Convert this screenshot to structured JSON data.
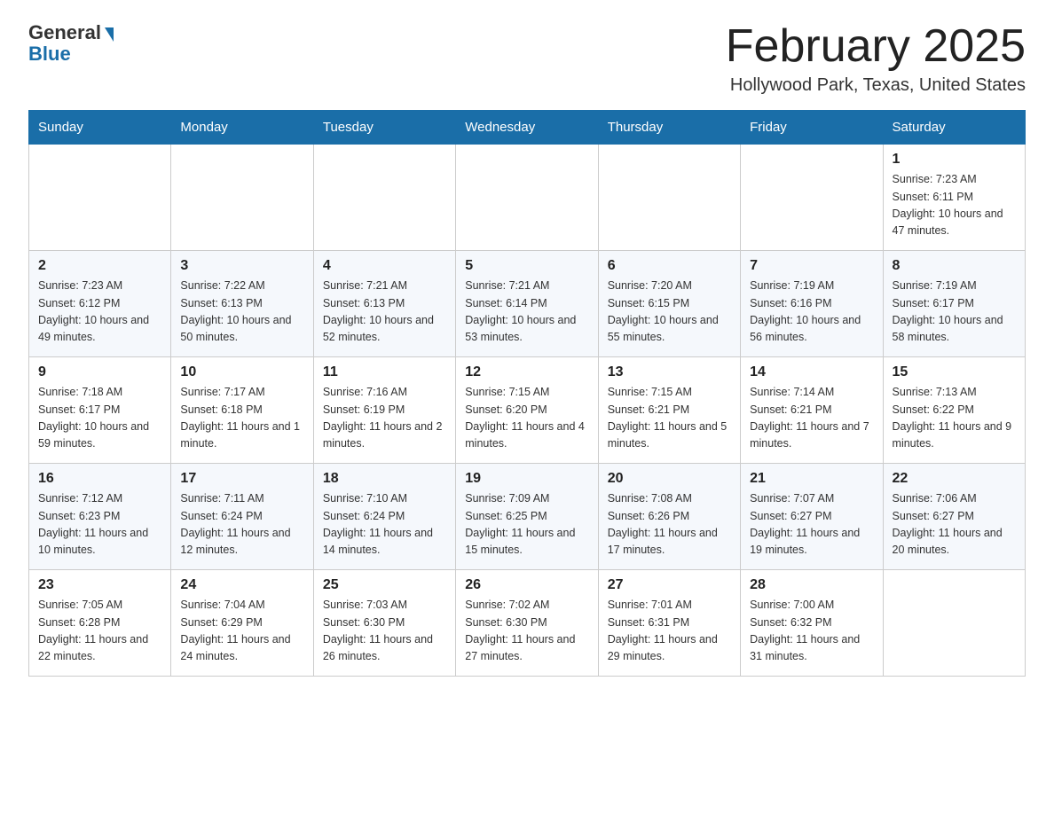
{
  "logo": {
    "general": "General",
    "blue": "Blue"
  },
  "title": "February 2025",
  "location": "Hollywood Park, Texas, United States",
  "days_of_week": [
    "Sunday",
    "Monday",
    "Tuesday",
    "Wednesday",
    "Thursday",
    "Friday",
    "Saturday"
  ],
  "weeks": [
    [
      {
        "day": "",
        "info": ""
      },
      {
        "day": "",
        "info": ""
      },
      {
        "day": "",
        "info": ""
      },
      {
        "day": "",
        "info": ""
      },
      {
        "day": "",
        "info": ""
      },
      {
        "day": "",
        "info": ""
      },
      {
        "day": "1",
        "info": "Sunrise: 7:23 AM\nSunset: 6:11 PM\nDaylight: 10 hours and 47 minutes."
      }
    ],
    [
      {
        "day": "2",
        "info": "Sunrise: 7:23 AM\nSunset: 6:12 PM\nDaylight: 10 hours and 49 minutes."
      },
      {
        "day": "3",
        "info": "Sunrise: 7:22 AM\nSunset: 6:13 PM\nDaylight: 10 hours and 50 minutes."
      },
      {
        "day": "4",
        "info": "Sunrise: 7:21 AM\nSunset: 6:13 PM\nDaylight: 10 hours and 52 minutes."
      },
      {
        "day": "5",
        "info": "Sunrise: 7:21 AM\nSunset: 6:14 PM\nDaylight: 10 hours and 53 minutes."
      },
      {
        "day": "6",
        "info": "Sunrise: 7:20 AM\nSunset: 6:15 PM\nDaylight: 10 hours and 55 minutes."
      },
      {
        "day": "7",
        "info": "Sunrise: 7:19 AM\nSunset: 6:16 PM\nDaylight: 10 hours and 56 minutes."
      },
      {
        "day": "8",
        "info": "Sunrise: 7:19 AM\nSunset: 6:17 PM\nDaylight: 10 hours and 58 minutes."
      }
    ],
    [
      {
        "day": "9",
        "info": "Sunrise: 7:18 AM\nSunset: 6:17 PM\nDaylight: 10 hours and 59 minutes."
      },
      {
        "day": "10",
        "info": "Sunrise: 7:17 AM\nSunset: 6:18 PM\nDaylight: 11 hours and 1 minute."
      },
      {
        "day": "11",
        "info": "Sunrise: 7:16 AM\nSunset: 6:19 PM\nDaylight: 11 hours and 2 minutes."
      },
      {
        "day": "12",
        "info": "Sunrise: 7:15 AM\nSunset: 6:20 PM\nDaylight: 11 hours and 4 minutes."
      },
      {
        "day": "13",
        "info": "Sunrise: 7:15 AM\nSunset: 6:21 PM\nDaylight: 11 hours and 5 minutes."
      },
      {
        "day": "14",
        "info": "Sunrise: 7:14 AM\nSunset: 6:21 PM\nDaylight: 11 hours and 7 minutes."
      },
      {
        "day": "15",
        "info": "Sunrise: 7:13 AM\nSunset: 6:22 PM\nDaylight: 11 hours and 9 minutes."
      }
    ],
    [
      {
        "day": "16",
        "info": "Sunrise: 7:12 AM\nSunset: 6:23 PM\nDaylight: 11 hours and 10 minutes."
      },
      {
        "day": "17",
        "info": "Sunrise: 7:11 AM\nSunset: 6:24 PM\nDaylight: 11 hours and 12 minutes."
      },
      {
        "day": "18",
        "info": "Sunrise: 7:10 AM\nSunset: 6:24 PM\nDaylight: 11 hours and 14 minutes."
      },
      {
        "day": "19",
        "info": "Sunrise: 7:09 AM\nSunset: 6:25 PM\nDaylight: 11 hours and 15 minutes."
      },
      {
        "day": "20",
        "info": "Sunrise: 7:08 AM\nSunset: 6:26 PM\nDaylight: 11 hours and 17 minutes."
      },
      {
        "day": "21",
        "info": "Sunrise: 7:07 AM\nSunset: 6:27 PM\nDaylight: 11 hours and 19 minutes."
      },
      {
        "day": "22",
        "info": "Sunrise: 7:06 AM\nSunset: 6:27 PM\nDaylight: 11 hours and 20 minutes."
      }
    ],
    [
      {
        "day": "23",
        "info": "Sunrise: 7:05 AM\nSunset: 6:28 PM\nDaylight: 11 hours and 22 minutes."
      },
      {
        "day": "24",
        "info": "Sunrise: 7:04 AM\nSunset: 6:29 PM\nDaylight: 11 hours and 24 minutes."
      },
      {
        "day": "25",
        "info": "Sunrise: 7:03 AM\nSunset: 6:30 PM\nDaylight: 11 hours and 26 minutes."
      },
      {
        "day": "26",
        "info": "Sunrise: 7:02 AM\nSunset: 6:30 PM\nDaylight: 11 hours and 27 minutes."
      },
      {
        "day": "27",
        "info": "Sunrise: 7:01 AM\nSunset: 6:31 PM\nDaylight: 11 hours and 29 minutes."
      },
      {
        "day": "28",
        "info": "Sunrise: 7:00 AM\nSunset: 6:32 PM\nDaylight: 11 hours and 31 minutes."
      },
      {
        "day": "",
        "info": ""
      }
    ]
  ]
}
